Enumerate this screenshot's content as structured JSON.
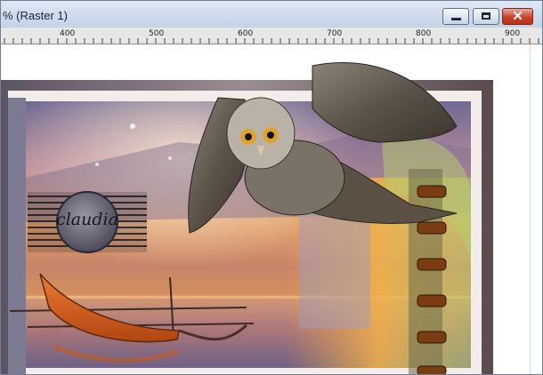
{
  "window": {
    "title": "% (Raster 1)",
    "buttons": {
      "minimize": "minimize",
      "maximize": "maximize",
      "close": "✕"
    }
  },
  "ruler": {
    "labels": [
      "400",
      "500",
      "600",
      "700",
      "800",
      "900"
    ]
  },
  "canvas": {
    "logo_text": "claudia"
  },
  "colors": {
    "titlebar": "#c3d2e6",
    "close_button": "#c8412a",
    "frame_border": "#7b6d6f",
    "sky_warm": "#e88b3c",
    "boat": "#d65a1c"
  }
}
